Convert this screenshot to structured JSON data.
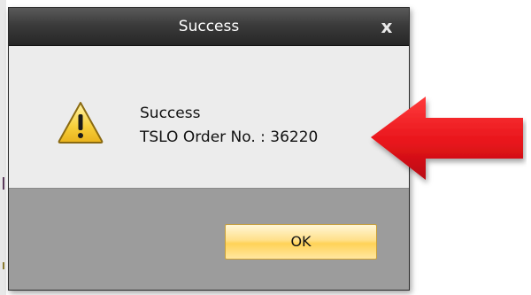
{
  "dialog": {
    "title": "Success",
    "close_glyph": "x",
    "message_line1": "Success",
    "message_line2": "TSLO Order No. : 36220",
    "ok_label": "OK",
    "icon": "warning-icon"
  },
  "annotation": {
    "icon": "red-arrow-icon",
    "color": "#e8141b"
  },
  "colors": {
    "titlebar": "#3b3b3b",
    "content_bg": "#ececec",
    "footer_bg": "#9c9c9c",
    "ok_button": "#ffd257"
  }
}
